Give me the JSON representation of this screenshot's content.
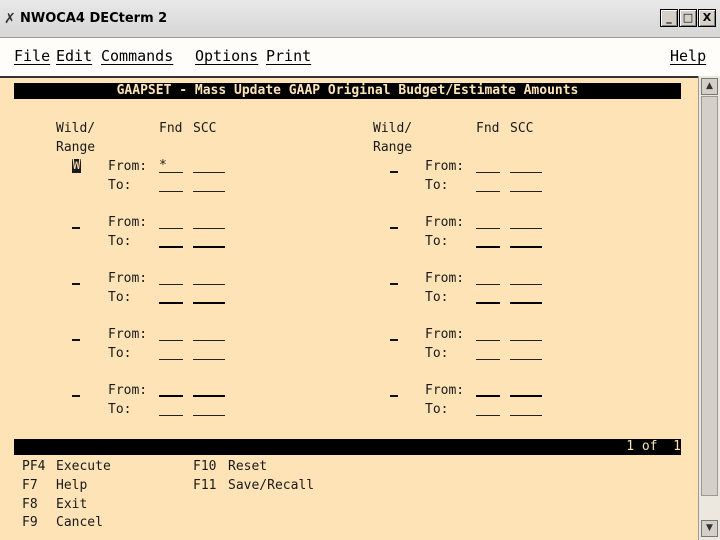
{
  "window": {
    "title": "NWOCA4 DECterm 2",
    "icon": "decterm-x-icon",
    "controls": {
      "minimize": "_",
      "maximize": "□",
      "close": "X"
    }
  },
  "menu": {
    "file": "File",
    "edit": "Edit",
    "commands": "Commands",
    "options": "Options",
    "print": "Print",
    "help": "Help"
  },
  "screen": {
    "header": "GAAPSET - Mass Update GAAP Original Budget/Estimate Amounts",
    "left_col": {
      "wild": "Wild/",
      "range": "Range",
      "fnd": "Fnd",
      "scc": "SCC"
    },
    "right_col": {
      "wild": "Wild/",
      "range": "Range",
      "fnd": "Fnd",
      "scc": "SCC"
    },
    "from_label": "From:",
    "to_label": "To:",
    "first_fnd_value": "*",
    "cursor_value": "W",
    "status_text": "Mass Update GAAP Original Budget/Estimate Amounts",
    "page_indicator": "1 of  1"
  },
  "keys": [
    {
      "key": "PF4",
      "action": "Execute"
    },
    {
      "key": "F7",
      "action": "Help"
    },
    {
      "key": "F8",
      "action": "Exit"
    },
    {
      "key": "F9",
      "action": "Cancel"
    },
    {
      "key": "F10",
      "action": "Reset"
    },
    {
      "key": "F11",
      "action": "Save/Recall"
    }
  ]
}
